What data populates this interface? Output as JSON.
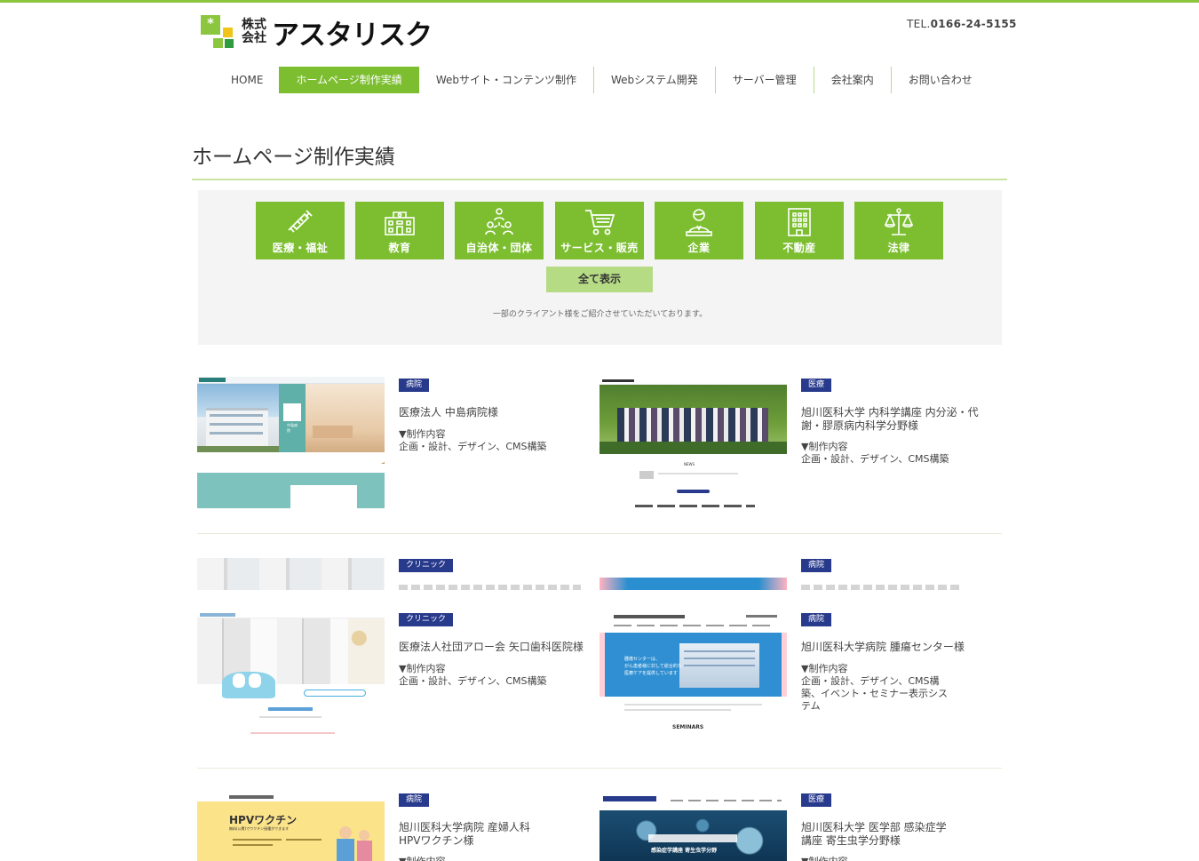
{
  "header": {
    "logo_sub": "株式会社",
    "logo_name": "アスタリスク",
    "tel_prefix": "TEL.",
    "tel_number": "0166-24-5155"
  },
  "nav": {
    "items": [
      {
        "label": "HOME"
      },
      {
        "label": "ホームページ制作実績",
        "active": true
      },
      {
        "label": "Webサイト・コンテンツ制作"
      },
      {
        "label": "Webシステム開発"
      },
      {
        "label": "サーバー管理"
      },
      {
        "label": "会社案内"
      },
      {
        "label": "お問い合わせ"
      }
    ]
  },
  "page": {
    "title": "ホームページ制作実績"
  },
  "categories": {
    "items": [
      {
        "label": "医療・福祉",
        "icon": "syringe-icon"
      },
      {
        "label": "教育",
        "icon": "school-icon"
      },
      {
        "label": "自治体・団体",
        "icon": "people-icon"
      },
      {
        "label": "サービス・販売",
        "icon": "cart-icon"
      },
      {
        "label": "企業",
        "icon": "businessperson-icon"
      },
      {
        "label": "不動産",
        "icon": "building-icon"
      },
      {
        "label": "法律",
        "icon": "scales-icon"
      }
    ],
    "show_all": "全て表示",
    "note": "一部のクライアント様をご紹介させていただいております。"
  },
  "works": {
    "content_label": "▼制作内容",
    "items": [
      {
        "tag": "病院",
        "title": "医療法人 中島病院様",
        "content": "企画・設計、デザイン、CMS構築"
      },
      {
        "tag": "医療",
        "title": "旭川医科大学 内科学講座 内分泌・代謝・膠原病内科学分野様",
        "content": "企画・設計、デザイン、CMS構築"
      },
      {
        "tag": "クリニック",
        "title": "医療法人社団アロー会 矢口歯科医院様",
        "content": "企画・設計、デザイン、CMS構築"
      },
      {
        "tag": "病院",
        "title": "旭川医科大学病院 腫瘍センター様",
        "content": "企画・設計、デザイン、CMS構築、イベント・セミナー表示システム"
      },
      {
        "tag": "病院",
        "title": "旭川医科大学病院 産婦人科 HPVワクチン様",
        "content": ""
      },
      {
        "tag": "医療",
        "title": "旭川医科大学 医学部 感染症学講座 寄生虫学分野様",
        "content": ""
      }
    ]
  },
  "thumbs": {
    "t1_label": "中島病院",
    "t2_label": "NEWS",
    "t4_line1": "腫瘍センターは、",
    "t4_line2": "がん患者様に対して総合的な",
    "t4_line3": "医療ケアを提供しています",
    "t4_seminars": "SEMINARS",
    "t5_title": "HPVワクチン",
    "t5_sub": "無料(公費)でワクチン接種ができます",
    "t6_label": "感染症学講座 寄生虫学分野"
  },
  "colors": {
    "brand_green": "#7cbe30",
    "light_green": "#b5db84",
    "tag_navy": "#283a8c"
  }
}
